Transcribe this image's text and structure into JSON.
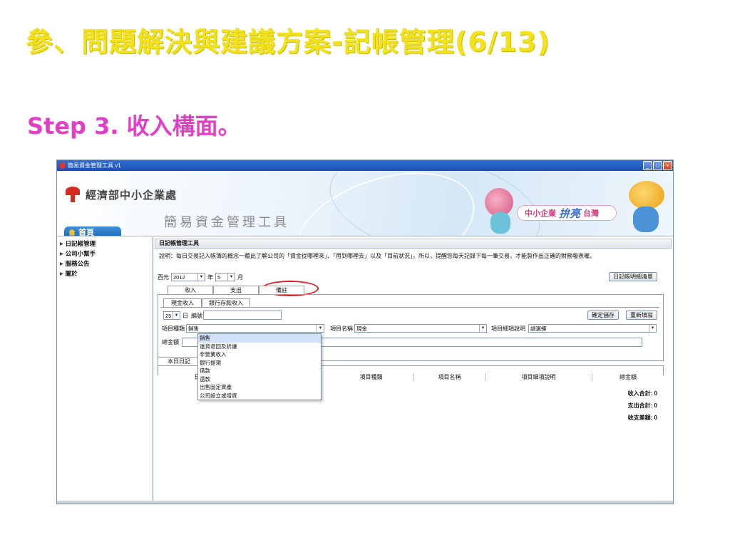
{
  "slide": {
    "title": "參、問題解決與建議方案-記帳管理(6/13)",
    "step": "Step 3. 收入構面。"
  },
  "window": {
    "title": "簡易資金管理工具 v1",
    "min": "_",
    "max": "□",
    "close": "×"
  },
  "banner": {
    "org": "經濟部中小企業處",
    "app_name": "簡易資金管理工具",
    "home": "首頁",
    "badge_small": "中小企業",
    "badge_big": "拚亮",
    "badge_tail": "台灣"
  },
  "sidebar": {
    "items": [
      {
        "label": "日記帳管理"
      },
      {
        "label": "公司小幫手"
      },
      {
        "label": "服務公告"
      },
      {
        "label": "關於"
      }
    ]
  },
  "panel": {
    "title": "日記帳管理工具",
    "desc": "說明：每日交易記入帳簿的概念一藉此了解公司的「資金從哪裡來」、「用到哪裡去」以及「目前狀況」。所以，提醒您每天記錄下每一筆交易，才能製作出正確的財務報表喔。",
    "era_label": "西元",
    "year": "2012",
    "year_unit": "年",
    "month": "5",
    "month_unit": "月",
    "detail_btn": "日記帳明細清單",
    "tabs": [
      "收入",
      "支出",
      "備註"
    ],
    "subtabs": [
      "現金收入",
      "銀行存款收入"
    ],
    "day": "25",
    "day_unit": "日",
    "serial_label": "編號",
    "save_btn": "確定儲存",
    "refill_btn": "重新填寫",
    "category_label": "項目種類",
    "category_value": "銷售",
    "name_label": "項目名稱",
    "name_value": "現金",
    "detail_label": "項目細項說明",
    "detail_value": "請選擇",
    "amount_label": "總金額",
    "today_tab": "本日日記",
    "columns": [
      "日期",
      "項目種類",
      "項目名稱",
      "項目細項說明",
      "總金額"
    ],
    "totals": {
      "income": "收入合計: 0",
      "expense": "支出合計: 0",
      "diff": "收支差額: 0"
    }
  },
  "dropdown": {
    "options": [
      "銷售",
      "進貨退回及折讓",
      "非營業收入",
      "銀行提現",
      "借款",
      "還款",
      "出售固定資產",
      "公司設立或增資"
    ],
    "selected": "銷售"
  },
  "colors": {
    "slide_title": "#f2e21e",
    "step_title": "#e23fc6",
    "highlight": "#e02020",
    "titlebar": "#2f6fd6"
  }
}
